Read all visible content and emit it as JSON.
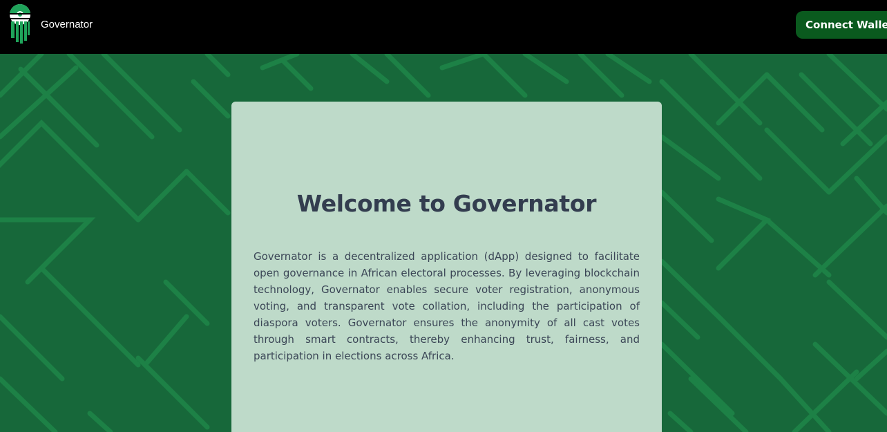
{
  "navbar": {
    "brand": "Governator",
    "connect_label": "Connect Wallet",
    "logo_icon": "governator-logo-icon"
  },
  "hero": {
    "title": "Welcome to Governator",
    "description": "Governator is a decentralized application (dApp) designed to facilitate open governance in African electoral processes. By leveraging blockchain technology, Governator enables secure voter registration, anonymous voting, and transparent vote collation, including the participation of diaspora voters. Governator ensures the anonymity of all cast votes through smart contracts, thereby enhancing trust, fairness, and participation in elections across Africa."
  },
  "colors": {
    "navbar_bg": "#000000",
    "page_bg": "#17683a",
    "pattern_line": "#1f8a4a",
    "card_bg": "#cde4d6",
    "button_bg": "#0a5a1e",
    "title_text": "#333d4f"
  }
}
